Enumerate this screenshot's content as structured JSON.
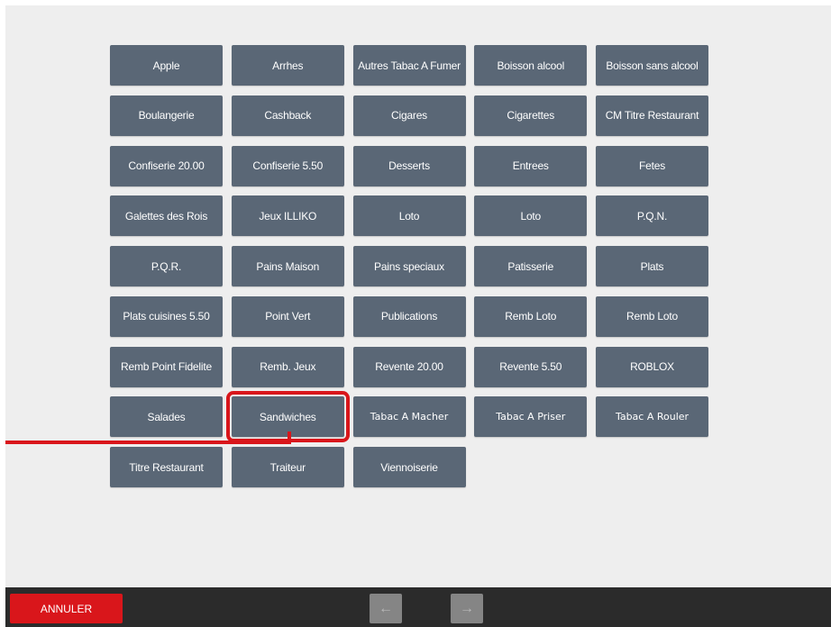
{
  "categories": [
    "Apple",
    "Arrhes",
    "Autres Tabac A Fumer",
    "Boisson alcool",
    "Boisson sans alcool",
    "Boulangerie",
    "Cashback",
    "Cigares",
    "Cigarettes",
    "CM Titre Restaurant",
    "Confiserie 20.00",
    "Confiserie 5.50",
    "Desserts",
    "Entrees",
    "Fetes",
    "Galettes des Rois",
    "Jeux ILLIKO",
    "Loto",
    "Loto",
    "P.Q.N.",
    "P.Q.R.",
    "Pains Maison",
    "Pains speciaux",
    "Patisserie",
    "Plats",
    "Plats cuisines 5.50",
    "Point Vert",
    "Publications",
    "Remb Loto",
    "Remb Loto",
    "Remb Point Fidelite",
    "Remb. Jeux",
    "Revente 20.00",
    "Revente 5.50",
    "ROBLOX",
    "Salades",
    "Sandwiches",
    "Tabac A Macher",
    "Tabac A Priser",
    "Tabac A Rouler",
    "Titre Restaurant",
    "Traiteur",
    "Viennoiserie"
  ],
  "highlighted_category": "Sandwiches",
  "footer": {
    "cancel_label": "ANNULER",
    "prev_icon": "←",
    "next_icon": "→"
  },
  "colors": {
    "button_bg": "#5a6776",
    "highlight": "#d9161b",
    "cancel_bg": "#d9161b",
    "bottom_bar": "#2b2b2b",
    "background": "#eeeeee"
  }
}
